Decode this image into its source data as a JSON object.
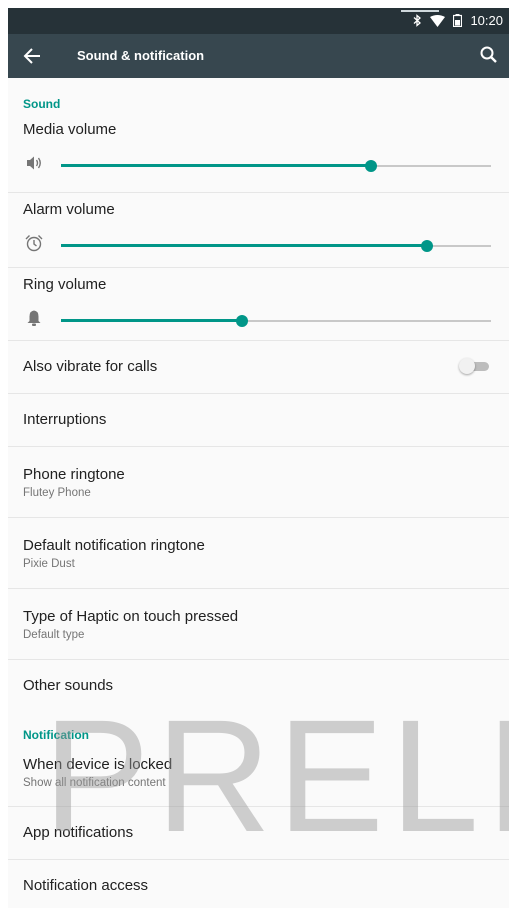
{
  "status_bar": {
    "time": "10:20",
    "icons": [
      "bluetooth-icon",
      "wifi-icon",
      "battery-icon"
    ]
  },
  "toolbar": {
    "title": "Sound & notification",
    "back_icon": "arrow-left-icon",
    "search_icon": "search-icon"
  },
  "sound": {
    "header": "Sound",
    "media_volume": {
      "label": "Media volume",
      "icon": "speaker-icon",
      "level": 0.72
    },
    "alarm_volume": {
      "label": "Alarm volume",
      "icon": "alarm-clock-icon",
      "level": 0.85
    },
    "ring_volume": {
      "label": "Ring volume",
      "icon": "bell-icon",
      "level": 0.42
    },
    "also_vibrate": {
      "label": "Also vibrate for calls",
      "checked": false
    },
    "interruptions": {
      "label": "Interruptions"
    },
    "phone_ringtone": {
      "label": "Phone ringtone",
      "value": "Flutey Phone"
    },
    "default_notification_ringtone": {
      "label": "Default notification ringtone",
      "value": "Pixie Dust"
    },
    "haptic_type": {
      "label": "Type of Haptic on touch pressed",
      "value": "Default type"
    },
    "other_sounds": {
      "label": "Other sounds"
    }
  },
  "notification": {
    "header": "Notification",
    "when_locked": {
      "label": "When device is locked",
      "value": "Show all notification content"
    },
    "app_notifications": {
      "label": "App notifications"
    },
    "notification_access": {
      "label": "Notification access"
    }
  },
  "watermark": "PRELI",
  "colors": {
    "accent": "#009688",
    "toolbar": "#37474f",
    "status_bar": "#263238"
  }
}
